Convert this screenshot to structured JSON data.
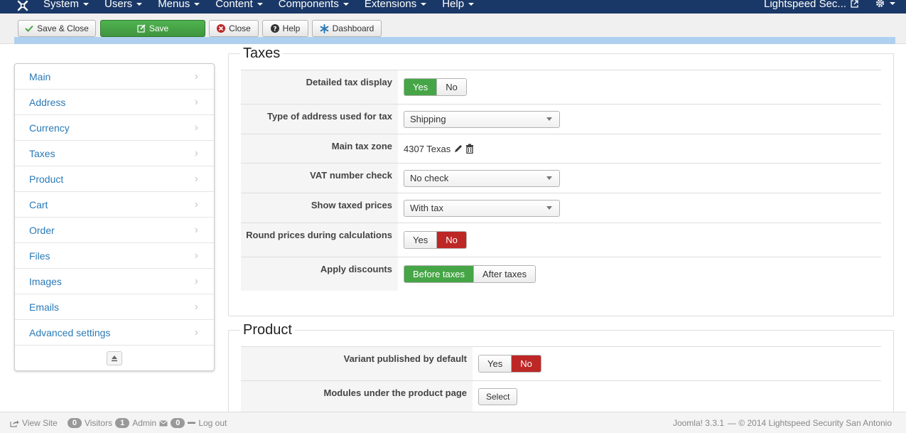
{
  "navbar": {
    "menu": [
      {
        "label": "System"
      },
      {
        "label": "Users"
      },
      {
        "label": "Menus"
      },
      {
        "label": "Content"
      },
      {
        "label": "Components"
      },
      {
        "label": "Extensions"
      },
      {
        "label": "Help"
      }
    ],
    "site_link": "Lightspeed Sec...",
    "accent": "#1a3867"
  },
  "toolbar": {
    "save_close": "Save & Close",
    "save": "Save",
    "close": "Close",
    "help": "Help",
    "dashboard": "Dashboard"
  },
  "sidebar": {
    "items": [
      {
        "label": "Main"
      },
      {
        "label": "Address"
      },
      {
        "label": "Currency"
      },
      {
        "label": "Taxes"
      },
      {
        "label": "Product"
      },
      {
        "label": "Cart"
      },
      {
        "label": "Order"
      },
      {
        "label": "Files"
      },
      {
        "label": "Images"
      },
      {
        "label": "Emails"
      },
      {
        "label": "Advanced settings"
      }
    ]
  },
  "taxes": {
    "legend": "Taxes",
    "detailed_tax_display": {
      "label": "Detailed tax display",
      "yes": "Yes",
      "no": "No",
      "selected": "yes"
    },
    "address_type": {
      "label": "Type of address used for tax",
      "value": "Shipping"
    },
    "main_tax_zone": {
      "label": "Main tax zone",
      "value": "4307 Texas"
    },
    "vat_check": {
      "label": "VAT number check",
      "value": "No check"
    },
    "show_taxed_prices": {
      "label": "Show taxed prices",
      "value": "With tax"
    },
    "round_prices": {
      "label": "Round prices during calculations",
      "yes": "Yes",
      "no": "No",
      "selected": "no"
    },
    "apply_discounts": {
      "label": "Apply discounts",
      "before": "Before taxes",
      "after": "After taxes",
      "selected": "before"
    }
  },
  "product": {
    "legend": "Product",
    "variant_published": {
      "label": "Variant published by default",
      "yes": "Yes",
      "no": "No",
      "selected": "no"
    },
    "modules": {
      "label": "Modules under the product page",
      "button": "Select"
    }
  },
  "statusbar": {
    "view_site": "View Site",
    "visitors_count": "0",
    "visitors": "Visitors",
    "admin_count": "1",
    "admin": "Admin",
    "messages_count": "0",
    "logout": "Log out",
    "version": "Joomla! 3.3.1",
    "copyright": "— © 2014 Lightspeed Security San Antonio"
  }
}
